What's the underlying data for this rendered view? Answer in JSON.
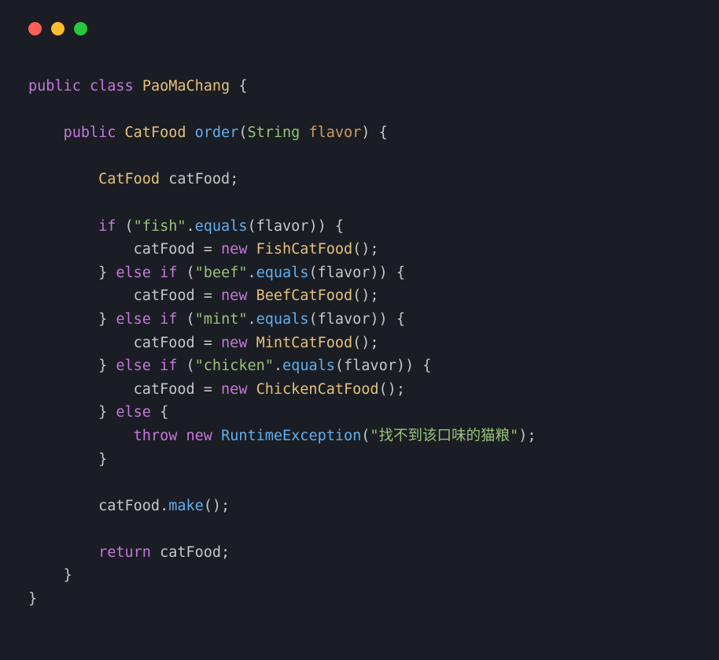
{
  "code": {
    "kw_public1": "public",
    "kw_class": "class",
    "class_name": "PaoMaChang",
    "kw_public2": "public",
    "ret_type": "CatFood",
    "method_name": "order",
    "param_type": "String",
    "param_name": "flavor",
    "decl_type": "CatFood",
    "decl_var": "catFood",
    "kw_if": "if",
    "str_fish": "\"fish\"",
    "equals": "equals",
    "flavor_ref1": "flavor",
    "assign1": "catFood",
    "kw_new1": "new",
    "ctor1": "FishCatFood",
    "kw_else1": "else",
    "kw_if2": "if",
    "str_beef": "\"beef\"",
    "flavor_ref2": "flavor",
    "assign2": "catFood",
    "kw_new2": "new",
    "ctor2": "BeefCatFood",
    "kw_else2": "else",
    "kw_if3": "if",
    "str_mint": "\"mint\"",
    "flavor_ref3": "flavor",
    "assign3": "catFood",
    "kw_new3": "new",
    "ctor3": "MintCatFood",
    "kw_else3": "else",
    "kw_if4": "if",
    "str_chicken": "\"chicken\"",
    "flavor_ref4": "flavor",
    "assign4": "catFood",
    "kw_new4": "new",
    "ctor4": "ChickenCatFood",
    "kw_else4": "else",
    "kw_throw": "throw",
    "kw_new5": "new",
    "exc_type": "RuntimeException",
    "exc_msg": "\"找不到该口味的猫粮\"",
    "call_obj": "catFood",
    "call_method": "make",
    "kw_return": "return",
    "ret_var": "catFood"
  }
}
